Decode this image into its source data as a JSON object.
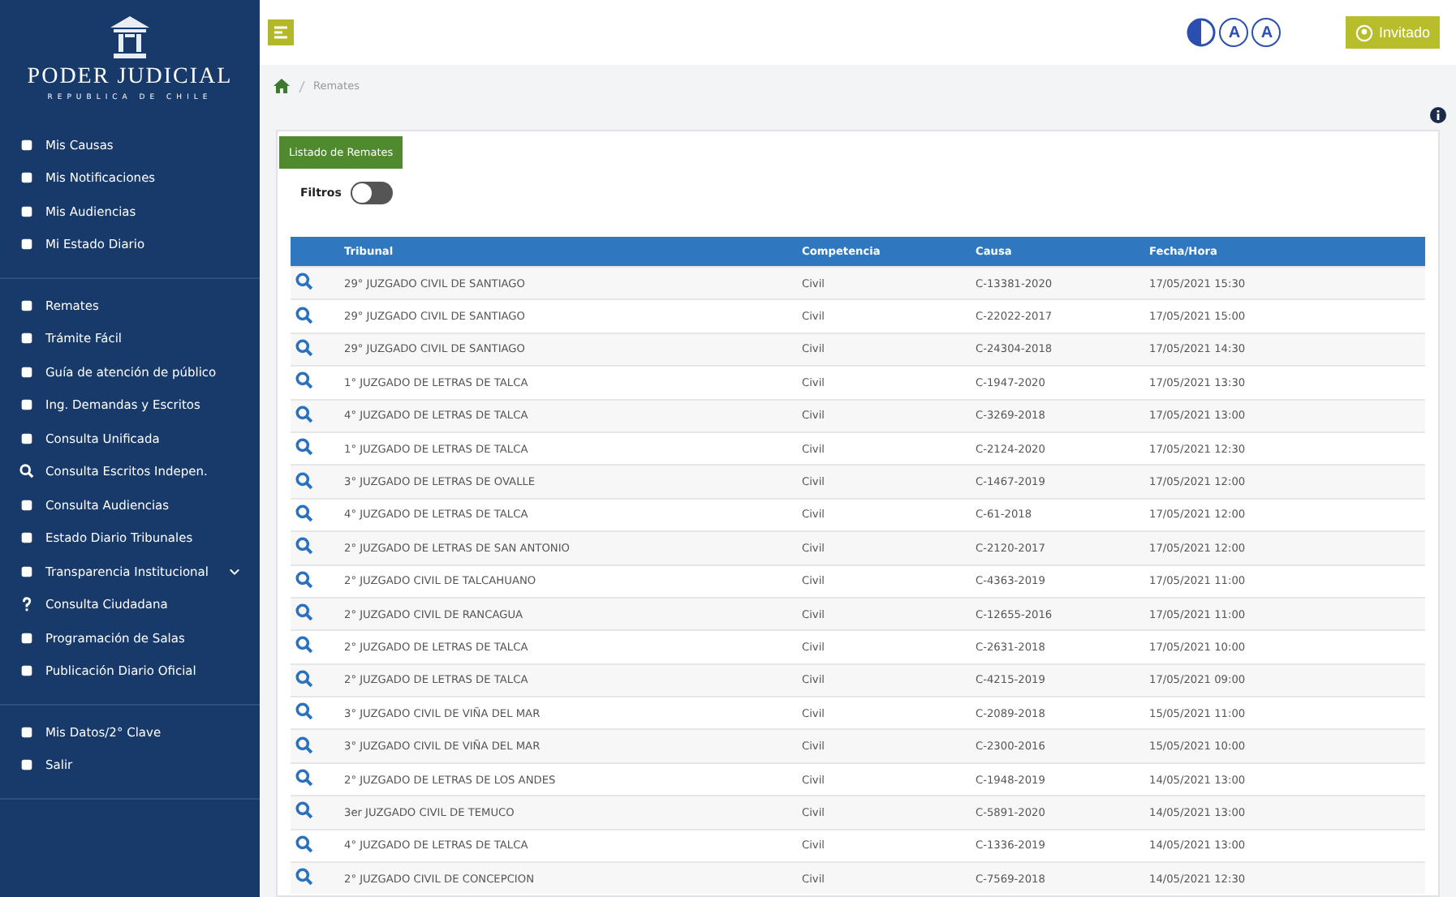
{
  "sidebar": {
    "brand": "PODER JUDICIAL",
    "tagline": "REPUBLICA DE CHILE",
    "groups": [
      [
        {
          "label": "Mis Causas"
        },
        {
          "label": "Mis Notificaciones"
        },
        {
          "label": "Mis Audiencias"
        },
        {
          "label": "Mi Estado Diario"
        }
      ],
      [
        {
          "label": "Remates"
        },
        {
          "label": "Trámite Fácil"
        },
        {
          "label": "Guía de atención de público"
        },
        {
          "label": "Ing. Demandas y Escritos"
        },
        {
          "label": "Consulta Unificada"
        },
        {
          "label": "Consulta Escritos Indepen."
        },
        {
          "label": "Consulta Audiencias"
        },
        {
          "label": "Estado Diario Tribunales"
        },
        {
          "label": "Transparencia Institucional",
          "expanded": false
        },
        {
          "label": "Consulta Ciudadana"
        },
        {
          "label": "Programación de Salas"
        },
        {
          "label": "Publicación Diario Oficial"
        }
      ],
      [
        {
          "label": "Mis Datos/2° Clave"
        },
        {
          "label": "Salir"
        }
      ]
    ]
  },
  "topbar": {
    "font_buttons": [
      "A",
      "A"
    ],
    "user_button": "Invitado"
  },
  "breadcrumb": [
    "Remates"
  ],
  "card": {
    "tab": "Listado de Remates",
    "filter_label": "Filtros",
    "filter_on": false
  },
  "table": {
    "columns": [
      "Tribunal",
      "Competencia",
      "Causa",
      "Fecha/Hora"
    ],
    "rows": [
      [
        "29° JUZGADO CIVIL DE SANTIAGO",
        "Civil",
        "C-13381-2020",
        "17/05/2021 15:30"
      ],
      [
        "29° JUZGADO CIVIL DE SANTIAGO",
        "Civil",
        "C-22022-2017",
        "17/05/2021 15:00"
      ],
      [
        "29° JUZGADO CIVIL DE SANTIAGO",
        "Civil",
        "C-24304-2018",
        "17/05/2021 14:30"
      ],
      [
        "1° JUZGADO DE LETRAS DE TALCA",
        "Civil",
        "C-1947-2020",
        "17/05/2021 13:30"
      ],
      [
        "4° JUZGADO DE LETRAS DE TALCA",
        "Civil",
        "C-3269-2018",
        "17/05/2021 13:00"
      ],
      [
        "1° JUZGADO DE LETRAS DE TALCA",
        "Civil",
        "C-2124-2020",
        "17/05/2021 12:30"
      ],
      [
        "3° JUZGADO DE LETRAS DE OVALLE",
        "Civil",
        "C-1467-2019",
        "17/05/2021 12:00"
      ],
      [
        "4° JUZGADO DE LETRAS DE TALCA",
        "Civil",
        "C-61-2018",
        "17/05/2021 12:00"
      ],
      [
        "2° JUZGADO DE LETRAS DE SAN ANTONIO",
        "Civil",
        "C-2120-2017",
        "17/05/2021 12:00"
      ],
      [
        "2° JUZGADO CIVIL DE TALCAHUANO",
        "Civil",
        "C-4363-2019",
        "17/05/2021 11:00"
      ],
      [
        "2° JUZGADO CIVIL DE RANCAGUA",
        "Civil",
        "C-12655-2016",
        "17/05/2021 11:00"
      ],
      [
        "2° JUZGADO DE LETRAS DE TALCA",
        "Civil",
        "C-2631-2018",
        "17/05/2021 10:00"
      ],
      [
        "2° JUZGADO DE LETRAS DE TALCA",
        "Civil",
        "C-4215-2019",
        "17/05/2021 09:00"
      ],
      [
        "3° JUZGADO CIVIL DE VIÑA DEL MAR",
        "Civil",
        "C-2089-2018",
        "15/05/2021 11:00"
      ],
      [
        "3° JUZGADO CIVIL DE VIÑA DEL MAR",
        "Civil",
        "C-2300-2016",
        "15/05/2021 10:00"
      ],
      [
        "2° JUZGADO DE LETRAS DE LOS ANDES",
        "Civil",
        "C-1948-2019",
        "14/05/2021 13:00"
      ],
      [
        "3er JUZGADO CIVIL DE TEMUCO",
        "Civil",
        "C-5891-2020",
        "14/05/2021 13:00"
      ],
      [
        "4° JUZGADO DE LETRAS DE TALCA",
        "Civil",
        "C-1336-2019",
        "14/05/2021 13:00"
      ],
      [
        "2° JUZGADO CIVIL DE CONCEPCION",
        "Civil",
        "C-7569-2018",
        "14/05/2021 12:30"
      ]
    ]
  }
}
